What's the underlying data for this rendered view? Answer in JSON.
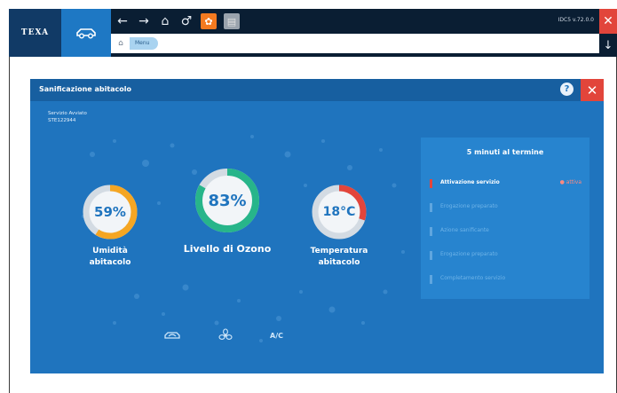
{
  "header": {
    "logo_text": "TEXA",
    "version_text": "IDC5 v.72.0.0",
    "version_suffix": "",
    "breadcrumb": "Menu",
    "icons": [
      "car-icon",
      "back-arrow-icon",
      "forward-arrow-icon",
      "home-icon",
      "link-icon",
      "settings-icon",
      "document-icon",
      "close-icon",
      "down-arrow-icon"
    ]
  },
  "dialog": {
    "title": "Sanificazione abitacolo",
    "service_line1": "Servizio Avviato",
    "service_line2": "STE122944"
  },
  "gauges": {
    "humidity": {
      "value": "59%",
      "label_line1": "Umidità",
      "label_line2": "abitacolo",
      "fraction": 0.59,
      "color": "#f5a623"
    },
    "ozone": {
      "value": "83%",
      "label": "Livello di Ozono",
      "fraction": 0.83,
      "color": "#27b58a"
    },
    "temperature": {
      "value": "18°C",
      "label_line1": "Temperatura",
      "label_line2": "abitacolo",
      "fraction": 0.3,
      "color": "#e2453b"
    }
  },
  "steps": {
    "title": "5 minuti al termine",
    "items": [
      {
        "label": "Attivazione servizio",
        "state": "● attiva",
        "active": true
      },
      {
        "label": "Erogazione preparato",
        "state": "",
        "active": false
      },
      {
        "label": "Azione sanificante",
        "state": "",
        "active": false
      },
      {
        "label": "Erogazione preparato",
        "state": "",
        "active": false
      },
      {
        "label": "Completamento servizio",
        "state": "",
        "active": false
      }
    ]
  },
  "bottom_icons": {
    "car_label": "car-icon",
    "fan_label": "fan-icon",
    "ac_text": "A/C"
  },
  "colors": {
    "dialog_bg": "#1f74be",
    "title_bar": "#175fa0",
    "accent_red": "#e2453b",
    "topbar": "#0a1e33"
  }
}
